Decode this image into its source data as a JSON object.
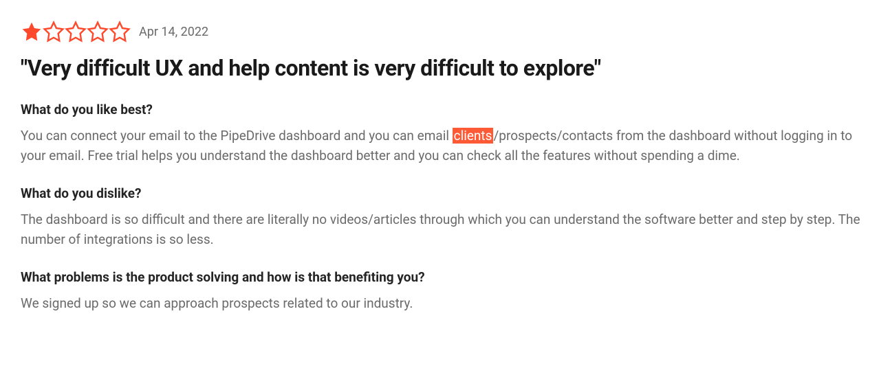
{
  "review": {
    "rating": 1,
    "max_rating": 5,
    "date": "Apr 14, 2022",
    "title": "\"Very difficult UX and help content is very difficult to explore\"",
    "colors": {
      "star": "#ff492c",
      "highlight_bg": "#ff5a36"
    },
    "sections": [
      {
        "question": "What do you like best?",
        "answer_before": "You can connect your email to the PipeDrive dashboard and you can email ",
        "highlight": "clients",
        "answer_after": "/prospects/contacts from the dashboard without logging in to your email. Free trial helps you understand the dashboard better and you can check all the features without spending a dime."
      },
      {
        "question": "What do you dislike?",
        "answer_before": "The dashboard is so difficult and there are literally no videos/articles through which you can understand the software better and step by step. The number of integrations is so less.",
        "highlight": "",
        "answer_after": ""
      },
      {
        "question": "What problems is the product solving and how is that benefiting you?",
        "answer_before": "We signed up so we can approach prospects related to our industry.",
        "highlight": "",
        "answer_after": ""
      }
    ]
  }
}
